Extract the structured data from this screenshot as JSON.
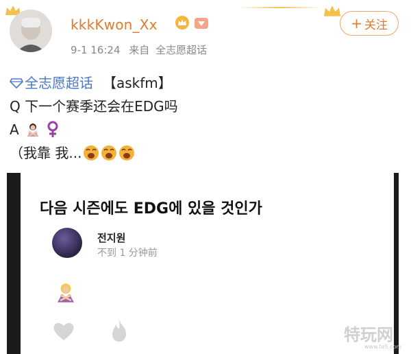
{
  "header": {
    "username": "kkkKwon_Xx",
    "timestamp": "9-1 16:24",
    "source_prefix": "来自",
    "source": "全志愿超话",
    "follow_plus": "+",
    "follow_label": "关注"
  },
  "post": {
    "topic": "全志愿超话",
    "tag": "【askfm】",
    "question_line": "Q 下一个赛季还会在EDG吗",
    "answer_prefix": "A",
    "comment_line": "（我靠 我..."
  },
  "card": {
    "title": "다음 시즌에도 EDG에 있을 것인가",
    "author": "전지원",
    "time": "不到 1 分钟前"
  },
  "watermark": {
    "text": "特玩网",
    "subtext": "www.te5.com"
  },
  "colors": {
    "username": "#e07a2f",
    "topic_link": "#4a78c8",
    "meta_gray": "#888888"
  },
  "icons": [
    "crown-icon",
    "super-topic-diamond-icon",
    "female-sign-icon",
    "crying-face-icon",
    "heart-icon",
    "fire-icon"
  ]
}
